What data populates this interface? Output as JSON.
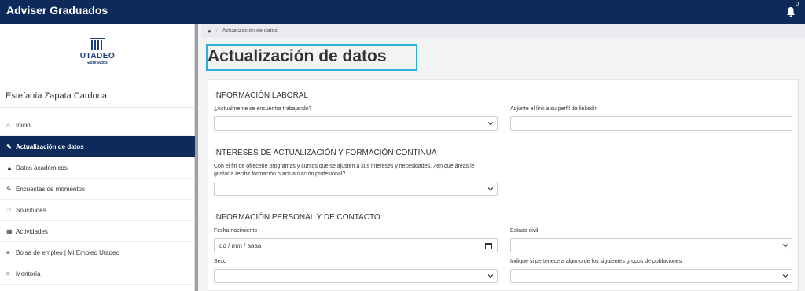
{
  "app": {
    "title": "Adviser Graduados",
    "notification_count": "0"
  },
  "logo": {
    "brand": "UTADEO",
    "sub": "Egresados"
  },
  "user": {
    "name": "Estefanía Zapata Cardona"
  },
  "sidebar": {
    "items": [
      {
        "label": "Inicio",
        "icon": "home-icon"
      },
      {
        "label": "Actualización de datos",
        "icon": "pencil-icon",
        "active": true
      },
      {
        "label": "Datos académicos",
        "icon": "graduation-cap-icon"
      },
      {
        "label": "Encuestas de momentos",
        "icon": "pencil-icon"
      },
      {
        "label": "Solicitudes",
        "icon": "hand-icon"
      },
      {
        "label": "Actividades",
        "icon": "calendar-icon"
      },
      {
        "label": "Bolsa de empleo | Mi Empleo Utadeo",
        "icon": "list-icon"
      },
      {
        "label": "Mentoría",
        "icon": "list-icon"
      }
    ]
  },
  "breadcrumb": {
    "home_icon": "user-icon",
    "current": "Actualización de datos"
  },
  "page": {
    "title": "Actualización de datos"
  },
  "form": {
    "laboral": {
      "title": "INFORMACIÓN LABORAL",
      "trabajando_label": "¿Actualmente se encuentra trabajando?",
      "trabajando_value": "",
      "linkedin_label": "Adjunte el link a su perfil de linkedin",
      "linkedin_value": ""
    },
    "intereses": {
      "title": "INTERESES DE ACTUALIZACIÓN Y FORMACIÓN CONTINUA",
      "areas_label_1": "Con el fin de ofrecerle programas y cursos que se ajusten a sus intereses y necesidades, ¿en qué áreas le",
      "areas_label_2": "gustaría recibir formación o actualización profesional?",
      "areas_value": ""
    },
    "personal": {
      "title": "INFORMACIÓN PERSONAL Y DE CONTACTO",
      "fecha_label": "Fecha nacimiento",
      "fecha_placeholder": "dd / mm / aaaa",
      "estado_civil_label": "Estado civil",
      "estado_civil_value": "",
      "sexo_label": "Sexo",
      "sexo_value": "",
      "grupos_label": "Indique si pertenece a alguno de los siguientes grupos de poblaciones",
      "grupos_value": ""
    }
  }
}
